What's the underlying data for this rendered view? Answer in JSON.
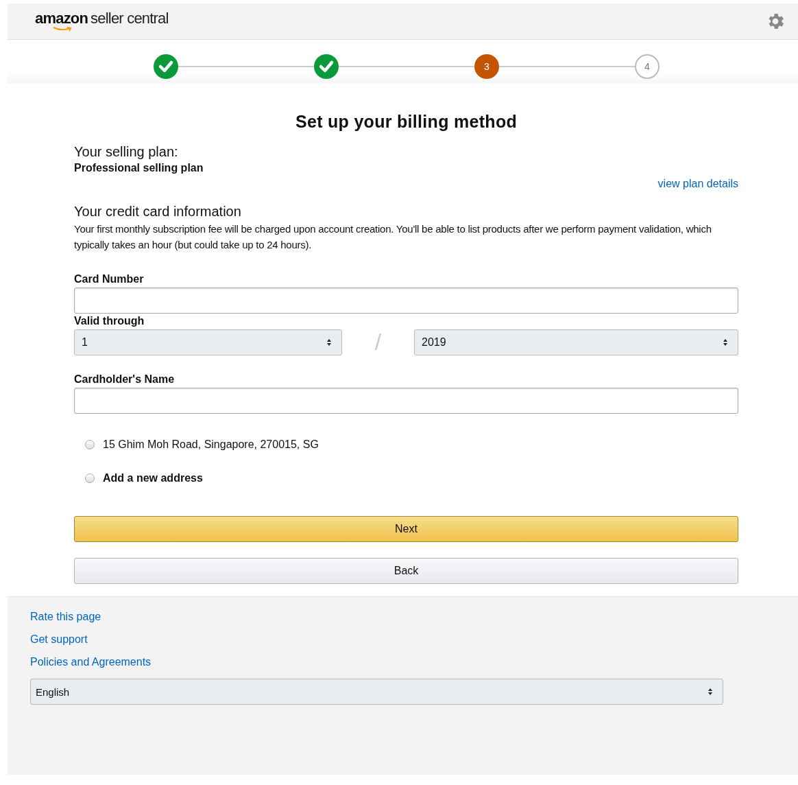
{
  "header": {
    "logo_brand": "amazon",
    "logo_product": "seller central"
  },
  "steps": [
    {
      "completed": true
    },
    {
      "completed": true
    },
    {
      "label": "3",
      "completed": false,
      "current": true
    },
    {
      "label": "4",
      "completed": false,
      "current": false
    }
  ],
  "title": "Set up your billing method",
  "plan": {
    "heading": "Your selling plan:",
    "name": "Professional selling plan",
    "link": "view plan details"
  },
  "card_info": {
    "heading": "Your credit card information",
    "description": "Your first monthly subscription fee will be charged upon account creation. You'll be able to list products after we perform payment validation, which typically takes an hour (but could take up to 24 hours)."
  },
  "fields": {
    "card_number": {
      "label": "Card Number"
    },
    "valid_through": {
      "label": "Valid through",
      "month": "1",
      "separator": "/",
      "year": "2019"
    },
    "cardholder": {
      "label": "Cardholder's Name"
    }
  },
  "addresses": [
    {
      "kind": "existing",
      "text": "15 Ghim Moh Road, Singapore, 270015, SG",
      "selected": false
    },
    {
      "kind": "new",
      "text": "Add a new address",
      "selected": false
    }
  ],
  "buttons": [
    {
      "kind": "primary",
      "label": "Next"
    },
    {
      "kind": "secondary",
      "label": "Back"
    }
  ],
  "footer": {
    "links": [
      "Rate this page",
      "Get support",
      "Policies and Agreements"
    ],
    "language": "English"
  }
}
